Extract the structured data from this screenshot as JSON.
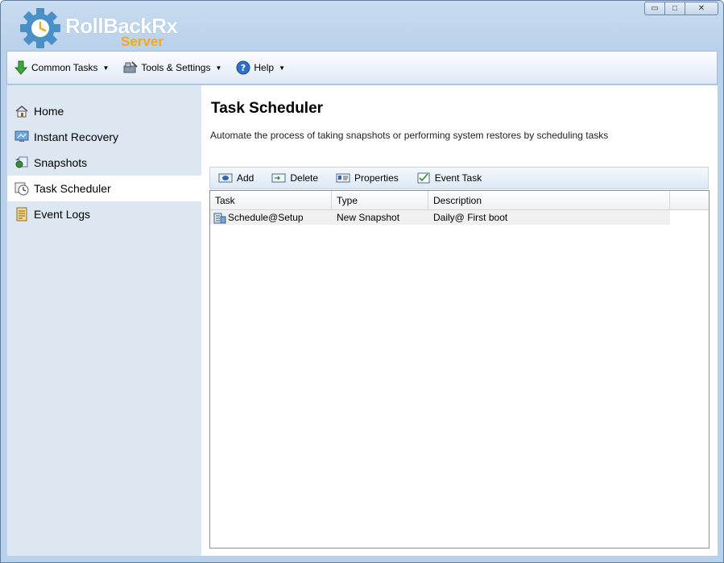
{
  "app": {
    "logo_main": "RollBackRx",
    "logo_sub": "Server"
  },
  "window_controls": {
    "minimize": "▭",
    "maximize": "□",
    "close": "✕"
  },
  "menubar": {
    "items": [
      {
        "label": "Common Tasks",
        "icon": "green-down-arrow-icon"
      },
      {
        "label": "Tools & Settings",
        "icon": "tools-icon"
      },
      {
        "label": "Help",
        "icon": "help-icon"
      }
    ]
  },
  "sidebar": {
    "items": [
      {
        "label": "Home",
        "icon": "home-icon",
        "active": false
      },
      {
        "label": "Instant Recovery",
        "icon": "recovery-monitor-icon",
        "active": false
      },
      {
        "label": "Snapshots",
        "icon": "snapshots-icon",
        "active": false
      },
      {
        "label": "Task Scheduler",
        "icon": "scheduler-clock-icon",
        "active": true
      },
      {
        "label": "Event Logs",
        "icon": "event-log-icon",
        "active": false
      }
    ]
  },
  "main": {
    "title": "Task Scheduler",
    "description": "Automate the process of taking snapshots or performing system restores by scheduling tasks",
    "toolbar": {
      "add": "Add",
      "delete": "Delete",
      "properties": "Properties",
      "event_task": "Event Task"
    },
    "table": {
      "columns": [
        "Task",
        "Type",
        "Description"
      ],
      "rows": [
        {
          "task": "Schedule@Setup",
          "type": "New Snapshot",
          "description": "Daily@ First boot"
        }
      ]
    }
  },
  "colors": {
    "window_frame": "#b9d1ea",
    "sidebar_bg": "#dde7f2",
    "logo_accent": "#f5a623",
    "logo_gear": "#4a90c8"
  }
}
